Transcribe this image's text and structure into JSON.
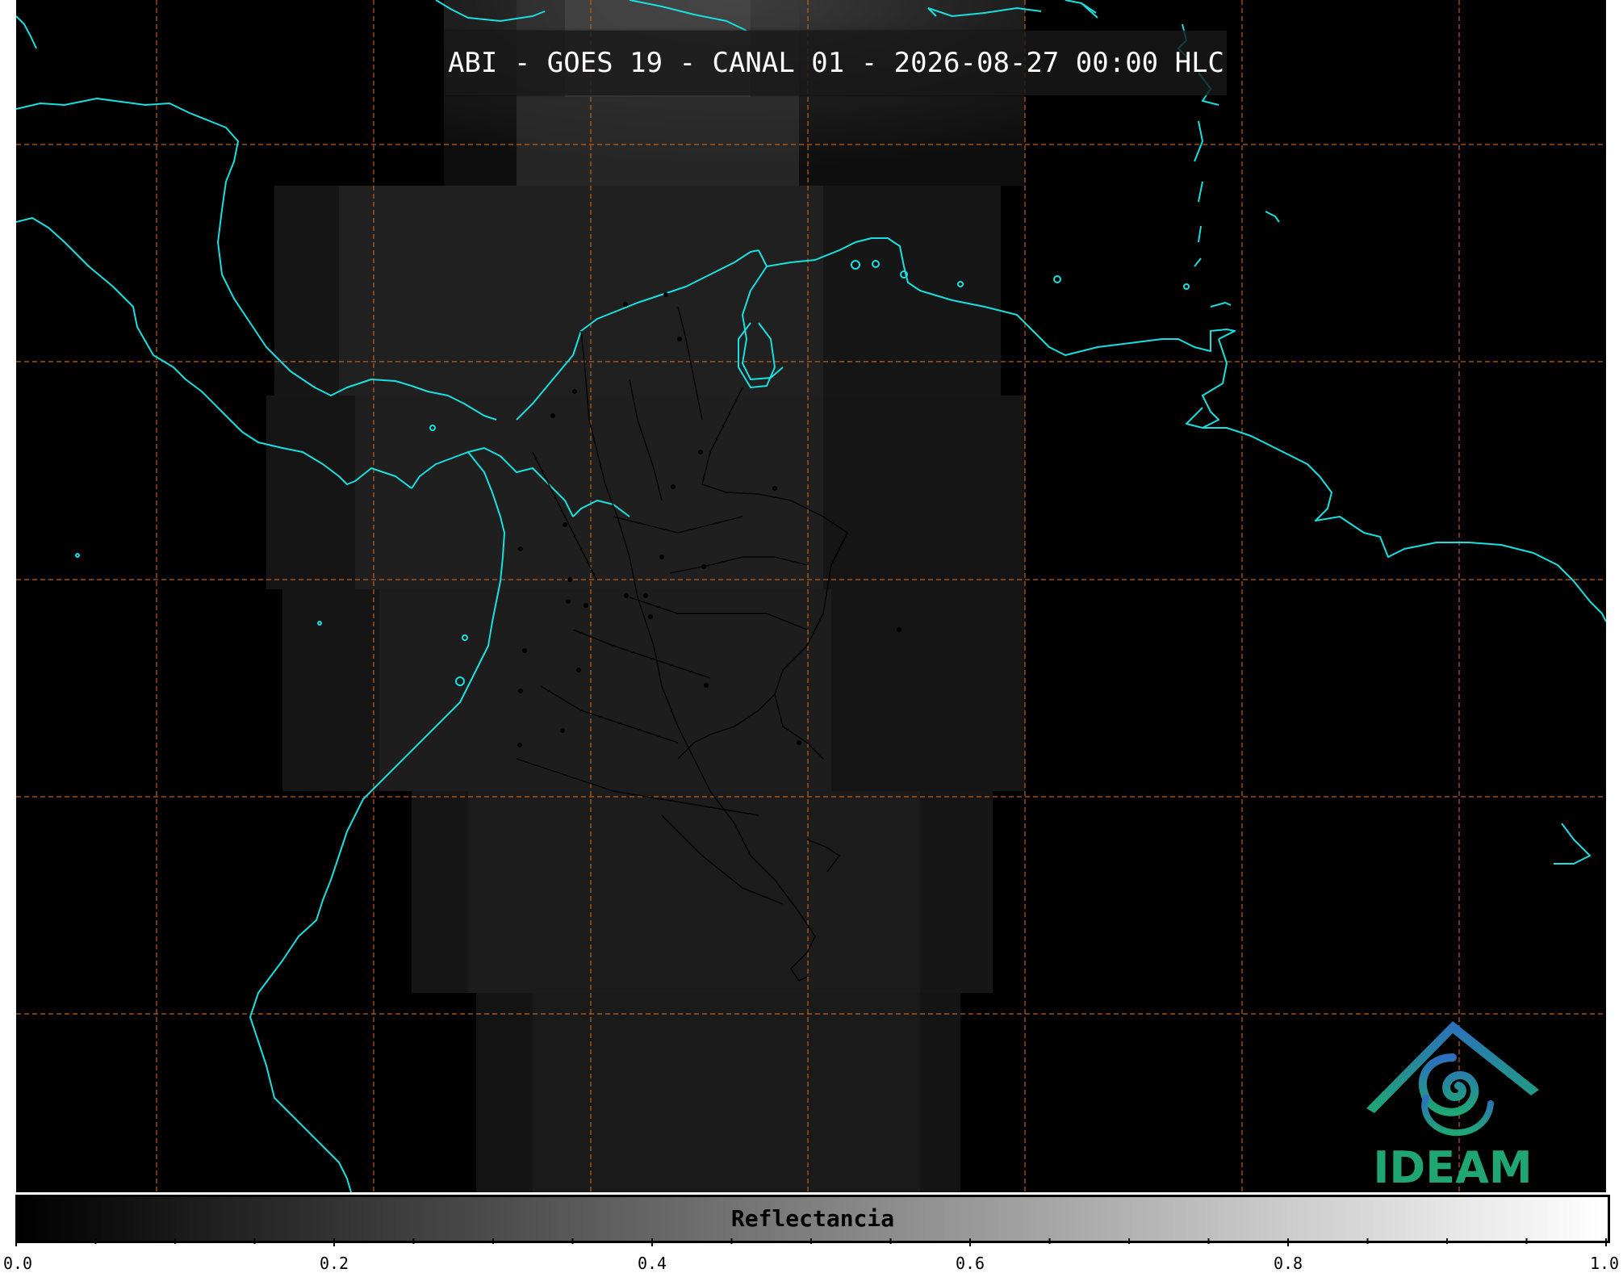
{
  "title": "ABI - GOES 19 - CANAL 01 - 2026-08-27 00:00 HLC",
  "logo": {
    "text": "IDEAM",
    "icon": "ideam-spiral-logo",
    "colors": {
      "blue": "#2c6fbf",
      "teal": "#1fa673"
    }
  },
  "map": {
    "background": "#000000",
    "coastline_color": "#19e0e0",
    "graticule_color": "#d2691e",
    "graticule_style": "dashed",
    "borders_color": "#000000"
  },
  "colorbar": {
    "label": "Reflectancia",
    "colormap": "grayscale",
    "range": [
      0.0,
      1.0
    ],
    "tick_labels": [
      "0.0",
      "0.2",
      "0.4",
      "0.6",
      "0.8",
      "1.0"
    ]
  }
}
